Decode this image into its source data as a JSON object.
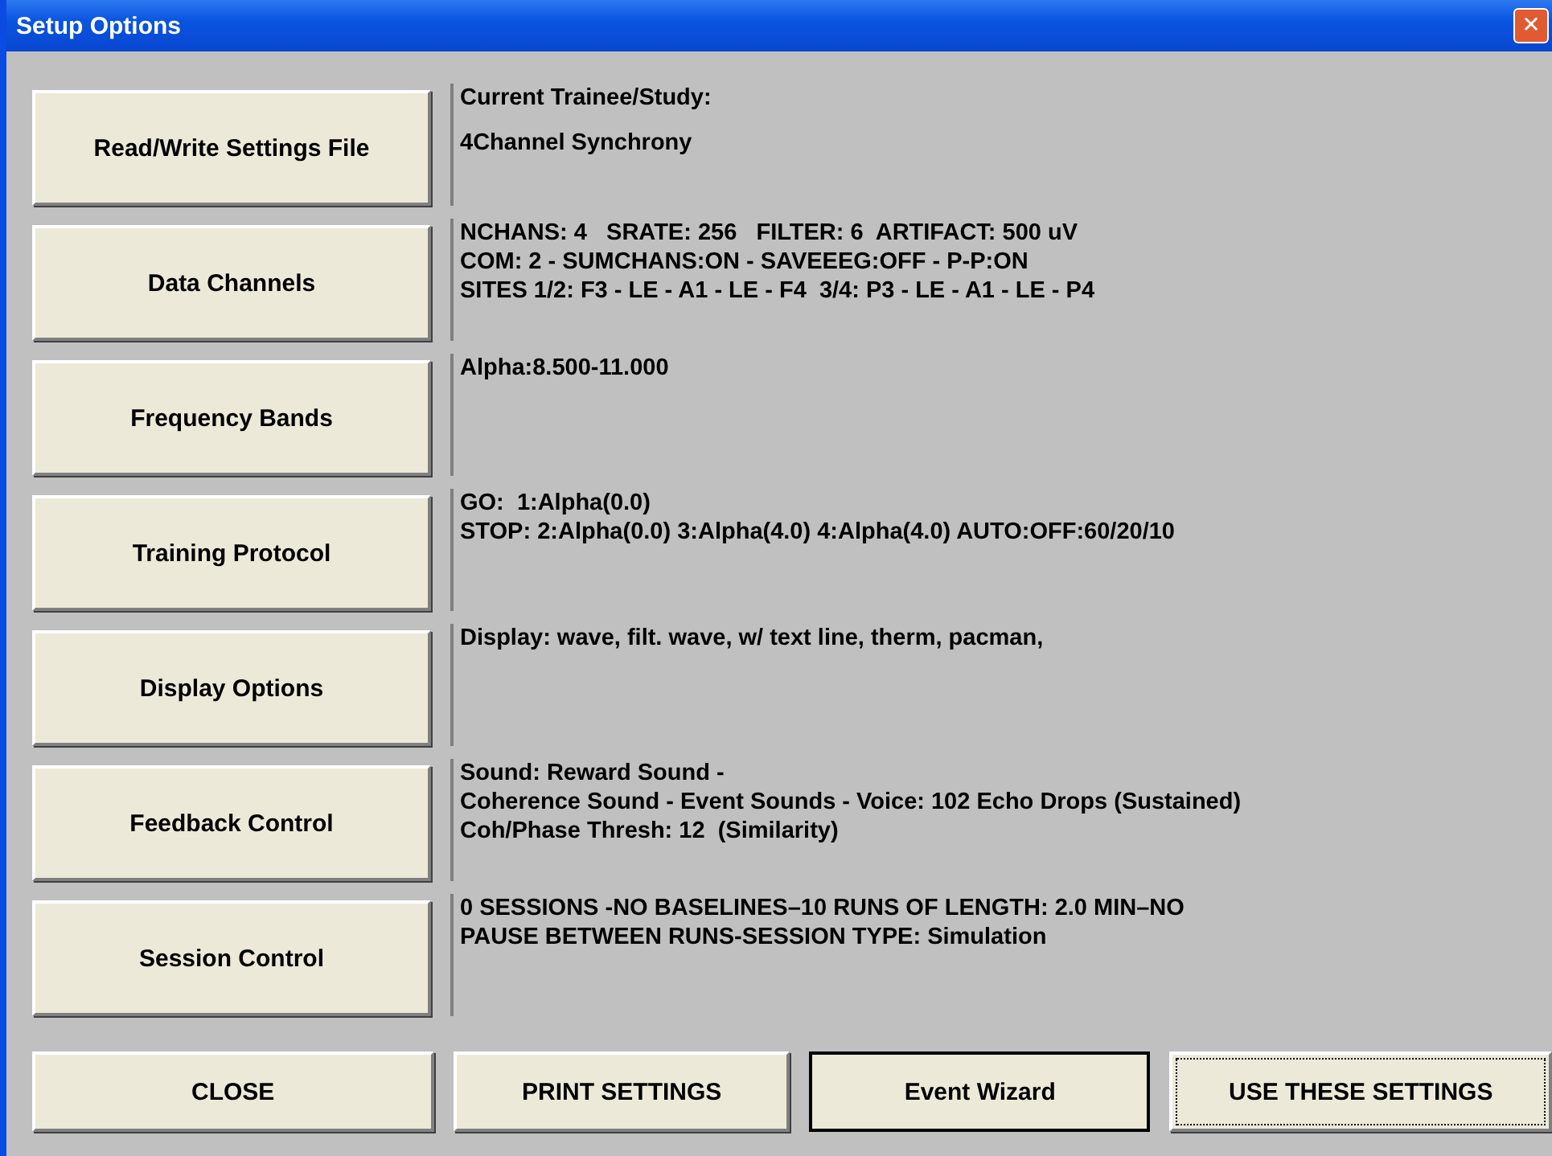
{
  "window": {
    "title": "Setup Options",
    "close_glyph": "✕"
  },
  "sections": [
    {
      "button": "Read/Write Settings File",
      "lines": [
        "Current Trainee/Study:",
        "4Channel Synchrony"
      ]
    },
    {
      "button": "Data Channels",
      "lines": [
        "NCHANS: 4   SRATE: 256   FILTER: 6  ARTIFACT: 500 uV",
        "COM: 2 - SUMCHANS:ON - SAVEEEG:OFF - P-P:ON",
        "SITES 1/2: F3 - LE - A1 - LE - F4  3/4: P3 - LE - A1 - LE - P4"
      ]
    },
    {
      "button": "Frequency Bands",
      "lines": [
        "Alpha:8.500-11.000"
      ]
    },
    {
      "button": "Training Protocol",
      "lines": [
        "GO:  1:Alpha(0.0)",
        "STOP: 2:Alpha(0.0) 3:Alpha(4.0) 4:Alpha(4.0) AUTO:OFF:60/20/10"
      ]
    },
    {
      "button": "Display Options",
      "lines": [
        "Display: wave, filt. wave, w/ text line, therm, pacman,"
      ]
    },
    {
      "button": "Feedback Control",
      "lines": [
        "Sound: Reward Sound -",
        "Coherence Sound - Event Sounds - Voice: 102 Echo Drops (Sustained)",
        "Coh/Phase Thresh: 12  (Similarity)"
      ]
    },
    {
      "button": "Session Control",
      "lines": [
        "0 SESSIONS -NO BASELINES–10 RUNS OF LENGTH: 2.0 MIN–NO",
        "PAUSE BETWEEN RUNS-SESSION TYPE: Simulation"
      ]
    }
  ],
  "buttons": [
    {
      "label": "CLOSE",
      "default": false,
      "focused": false
    },
    {
      "label": "PRINT SETTINGS",
      "default": false,
      "focused": false
    },
    {
      "label": "Event Wizard",
      "default": true,
      "focused": false
    },
    {
      "label": "USE THESE SETTINGS",
      "default": false,
      "focused": true
    }
  ]
}
